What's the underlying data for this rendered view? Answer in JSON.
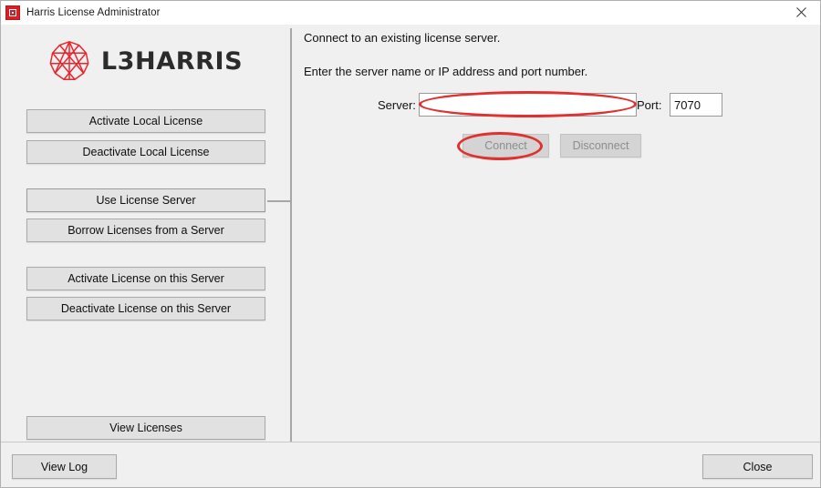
{
  "window": {
    "title": "Harris License Administrator",
    "app_icon": "harris-app-icon",
    "close_icon": "close-icon"
  },
  "brand": {
    "mark_icon": "l3harris-globe-icon",
    "wordmark": "L3HARRIS",
    "accent_color": "#e8262d"
  },
  "sidebar": {
    "items": [
      {
        "label": "Activate Local License",
        "selected": false
      },
      {
        "label": "Deactivate Local License",
        "selected": false
      },
      {
        "label": "Use License Server",
        "selected": true
      },
      {
        "label": "Borrow Licenses from a Server",
        "selected": false
      },
      {
        "label": "Activate License on this Server",
        "selected": false
      },
      {
        "label": "Deactivate License on this Server",
        "selected": false
      }
    ],
    "view_licenses_label": "View Licenses"
  },
  "panel": {
    "heading": "Connect to an existing license server.",
    "instruction": "Enter the server name or IP address and port number.",
    "server_label": "Server:",
    "server_value": "",
    "server_placeholder": "",
    "port_label": "Port:",
    "port_value": "7070",
    "connect_label": "Connect",
    "connect_enabled": false,
    "disconnect_label": "Disconnect",
    "disconnect_enabled": false
  },
  "footer": {
    "view_log_label": "View Log",
    "close_label": "Close"
  },
  "annotations": {
    "color": "#e03030",
    "shapes": [
      {
        "name": "server-field-highlight",
        "type": "ellipse"
      },
      {
        "name": "connect-button-highlight",
        "type": "ellipse"
      }
    ]
  }
}
